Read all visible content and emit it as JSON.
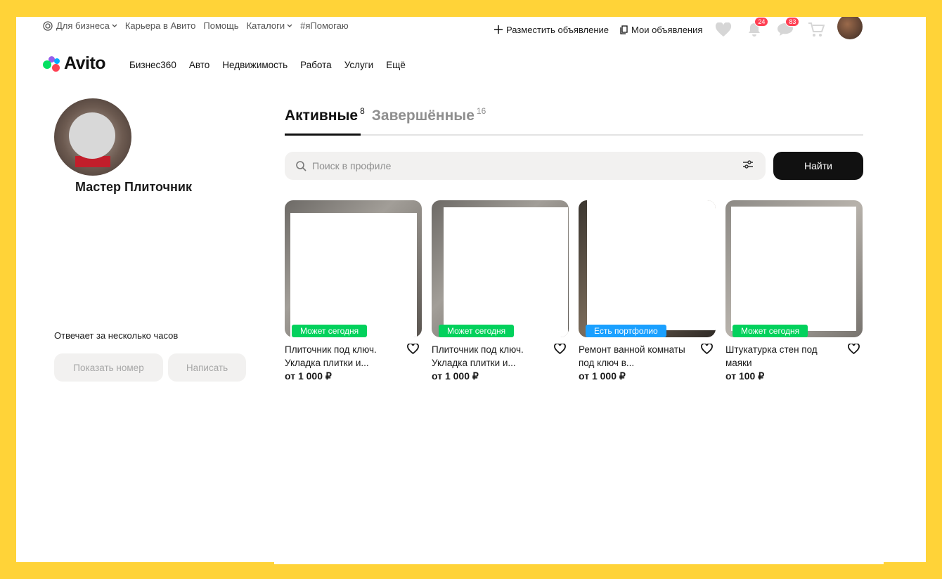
{
  "topbar": {
    "for_business": "Для бизнеса",
    "career": "Карьера в Авито",
    "help": "Помощь",
    "catalogs": "Каталоги",
    "ya_pomogayu": "#яПомогаю",
    "post_ad": "Разместить объявление",
    "my_ads": "Мои объявления",
    "notifications_count": "24",
    "messages_count": "83"
  },
  "logo": {
    "text": "Avito"
  },
  "categories": [
    "Бизнес360",
    "Авто",
    "Недвижимость",
    "Работа",
    "Услуги",
    "Ещё"
  ],
  "profile": {
    "name": "Мастер Плиточник",
    "responds": "Отвечает за несколько часов",
    "show_number": "Показать номер",
    "write": "Написать"
  },
  "tabs": {
    "active": {
      "label": "Активные",
      "count": "8"
    },
    "finished": {
      "label": "Завершённые",
      "count": "16"
    }
  },
  "search": {
    "placeholder": "Поиск в профиле",
    "button": "Найти"
  },
  "listings": [
    {
      "title": "Плиточник под ключ. Укладка плитки и...",
      "price": "от 1 000 ₽",
      "tag": "Может сегодня",
      "tag_color": "#02d15c"
    },
    {
      "title": "Плиточник под ключ. Укладка плитки и...",
      "price": "от 1 000 ₽",
      "tag": "Может сегодня",
      "tag_color": "#02d15c"
    },
    {
      "title": "Ремонт ванной комнаты под ключ в...",
      "price": "от 1 000 ₽",
      "tag": "Есть портфолио",
      "tag_color": "#1aa0ff"
    },
    {
      "title": "Штукатурка стен под маяки",
      "price": "от 100 ₽",
      "tag": "Может сегодня",
      "tag_color": "#02d15c"
    }
  ],
  "colors": {
    "background": "#ffd338",
    "accent_dark": "#111111",
    "badge": "#ff4053"
  }
}
